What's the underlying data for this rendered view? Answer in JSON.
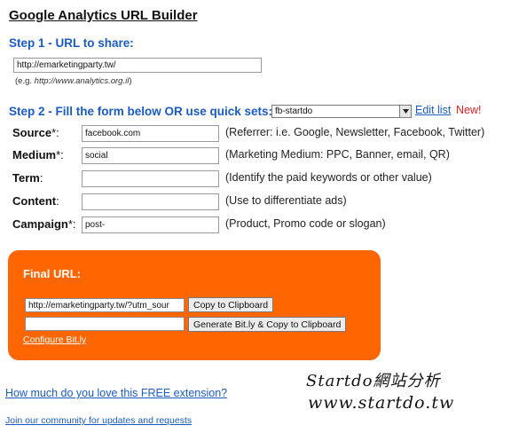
{
  "page": {
    "title": "Google Analytics URL Builder"
  },
  "step1": {
    "heading": "Step 1 - URL to share:",
    "url_value": "http://emarketingparty.tw/",
    "example_prefix": "(e.g. ",
    "example_url": "http://www.analytics.org.il",
    "example_suffix": ")"
  },
  "step2": {
    "heading": "Step 2 - Fill the form below OR use quick sets:",
    "quick_set_selected": "fb-startdo",
    "edit_list_label": "Edit list",
    "new_label": "New!"
  },
  "fields": [
    {
      "label": "Source",
      "required_mark": "*:",
      "value": "facebook.com",
      "help": "(Referrer: i.e. Google, Newsletter, Facebook, Twitter)"
    },
    {
      "label": "Medium",
      "required_mark": "*:",
      "value": "social",
      "help": "(Marketing Medium: PPC, Banner, email, QR)"
    },
    {
      "label": "Term",
      "required_mark": ":",
      "value": "",
      "help": "(Identify the paid keywords or other value)"
    },
    {
      "label": "Content",
      "required_mark": ":",
      "value": "",
      "help": "(Use to differentiate ads)"
    },
    {
      "label": "Campaign",
      "required_mark": "*:",
      "value": "post-",
      "help": "(Product, Promo code or slogan)"
    }
  ],
  "final": {
    "title": "Final URL:",
    "url_value": "http://emarketingparty.tw/?utm_sour",
    "bitly_value": "",
    "copy_button_label": "Copy to Clipboard",
    "bitly_button_label": "Generate Bit.ly & Copy to Clipboard",
    "configure_link_label": "Configure Bit.ly"
  },
  "footer": {
    "love_link": "How much do you love this FREE extension?",
    "community_link": "Join our community for updates and requests"
  },
  "watermark": {
    "line1": "Startdo網站分析",
    "line2": "www.startdo.tw"
  },
  "colors": {
    "accent_blue": "#1a5bc4",
    "final_box_orange": "#ff6600",
    "new_red": "#e0201f"
  },
  "icons": {
    "select_arrow": "chevron-down-icon"
  }
}
